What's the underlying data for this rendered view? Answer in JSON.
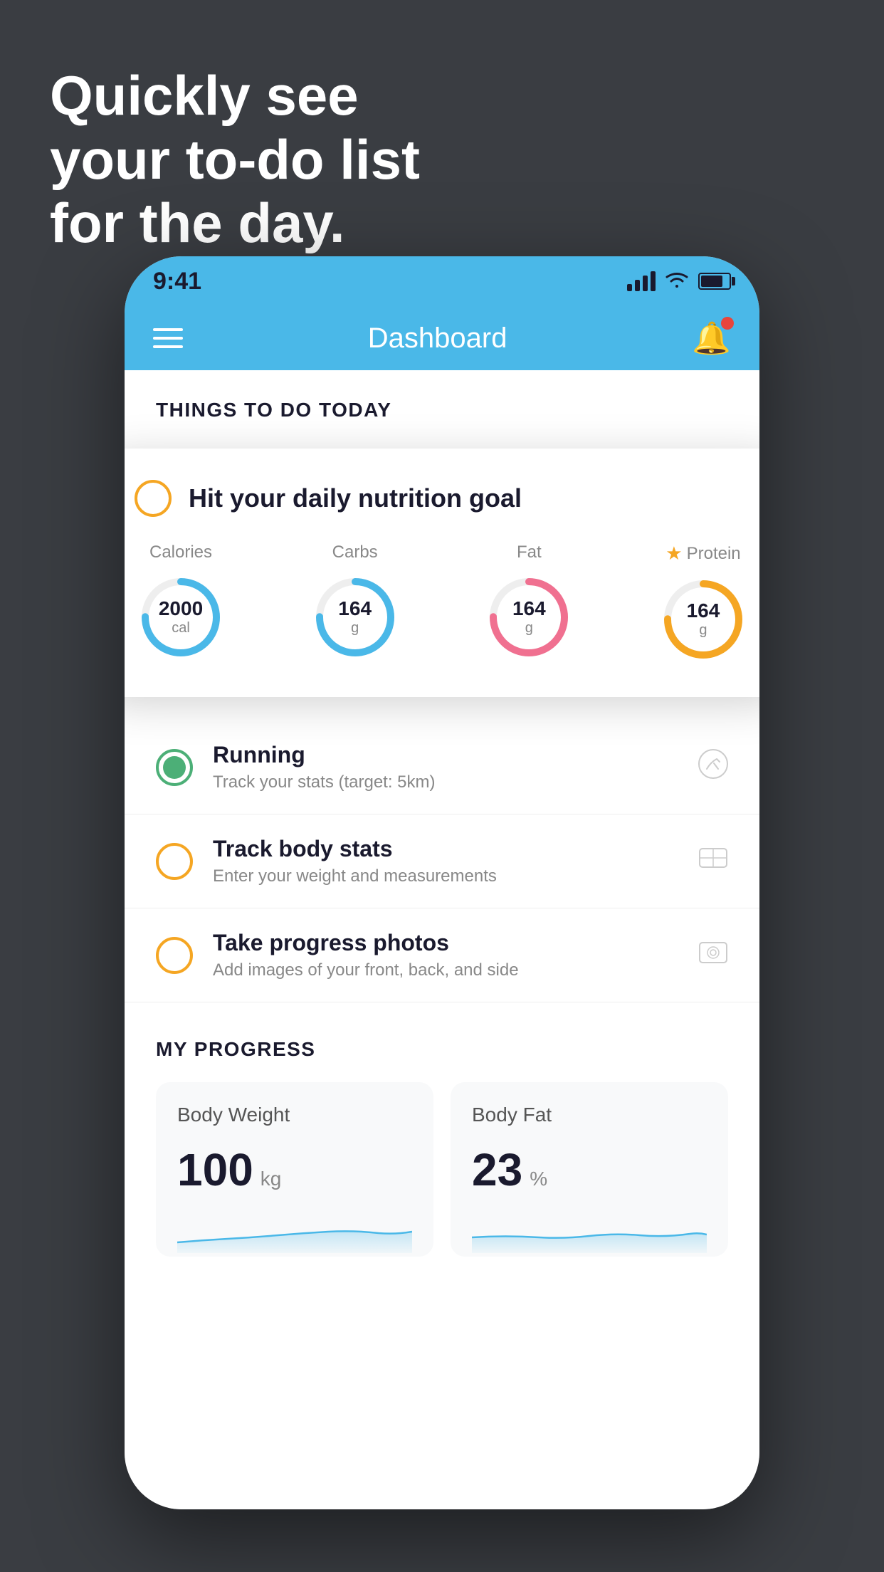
{
  "hero": {
    "line1": "Quickly see",
    "line2": "your to-do list",
    "line3": "for the day."
  },
  "statusBar": {
    "time": "9:41"
  },
  "navBar": {
    "title": "Dashboard"
  },
  "thingsToDo": {
    "sectionTitle": "THINGS TO DO TODAY",
    "card": {
      "title": "Hit your daily nutrition goal",
      "items": [
        {
          "label": "Calories",
          "value": "2000",
          "unit": "cal",
          "ring": "blue"
        },
        {
          "label": "Carbs",
          "value": "164",
          "unit": "g",
          "ring": "blue"
        },
        {
          "label": "Fat",
          "value": "164",
          "unit": "g",
          "ring": "pink"
        },
        {
          "label": "Protein",
          "value": "164",
          "unit": "g",
          "ring": "yellow",
          "starred": true
        }
      ]
    },
    "todos": [
      {
        "title": "Running",
        "subtitle": "Track your stats (target: 5km)",
        "checked": true,
        "icon": "👟"
      },
      {
        "title": "Track body stats",
        "subtitle": "Enter your weight and measurements",
        "checked": false,
        "icon": "⚖️"
      },
      {
        "title": "Take progress photos",
        "subtitle": "Add images of your front, back, and side",
        "checked": false,
        "icon": "🖼️"
      }
    ]
  },
  "progress": {
    "sectionTitle": "MY PROGRESS",
    "cards": [
      {
        "title": "Body Weight",
        "value": "100",
        "unit": "kg"
      },
      {
        "title": "Body Fat",
        "value": "23",
        "unit": "%"
      }
    ]
  }
}
